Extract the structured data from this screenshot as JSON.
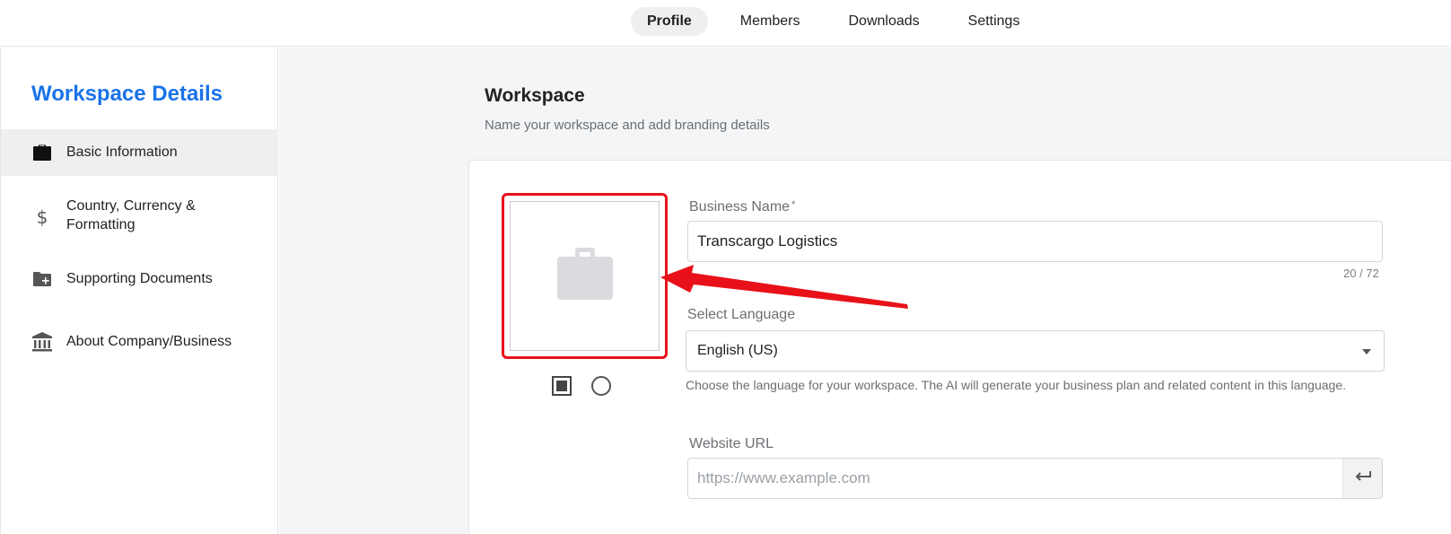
{
  "topnav": {
    "tabs": [
      {
        "label": "Profile",
        "active": true
      },
      {
        "label": "Members",
        "active": false
      },
      {
        "label": "Downloads",
        "active": false
      },
      {
        "label": "Settings",
        "active": false
      }
    ]
  },
  "sidebar": {
    "title": "Workspace Details",
    "items": [
      {
        "label": "Basic Information",
        "icon": "briefcase-icon",
        "active": true
      },
      {
        "label": "Country, Currency & Formatting",
        "icon": "dollar-icon",
        "active": false
      },
      {
        "label": "Supporting Documents",
        "icon": "folder-plus-icon",
        "active": false
      },
      {
        "label": "About Company/Business",
        "icon": "bank-icon",
        "active": false
      }
    ]
  },
  "main": {
    "title": "Workspace",
    "subtitle": "Name your workspace and add branding details",
    "logo": {
      "placeholder_icon": "briefcase-icon",
      "shape_options": [
        "square",
        "circle"
      ],
      "selected_shape": "square"
    },
    "business_name": {
      "label": "Business Name",
      "required_mark": "*",
      "value": "Transcargo Logistics",
      "counter": "20 / 72"
    },
    "language": {
      "label": "Select Language",
      "value": "English (US)",
      "helper": "Choose the language for your workspace. The AI will generate your business plan and related content in this language."
    },
    "website": {
      "label": "Website URL",
      "placeholder": "https://www.example.com",
      "value": ""
    }
  },
  "colors": {
    "accent": "#1a73e8",
    "highlight": "#e8111a"
  }
}
